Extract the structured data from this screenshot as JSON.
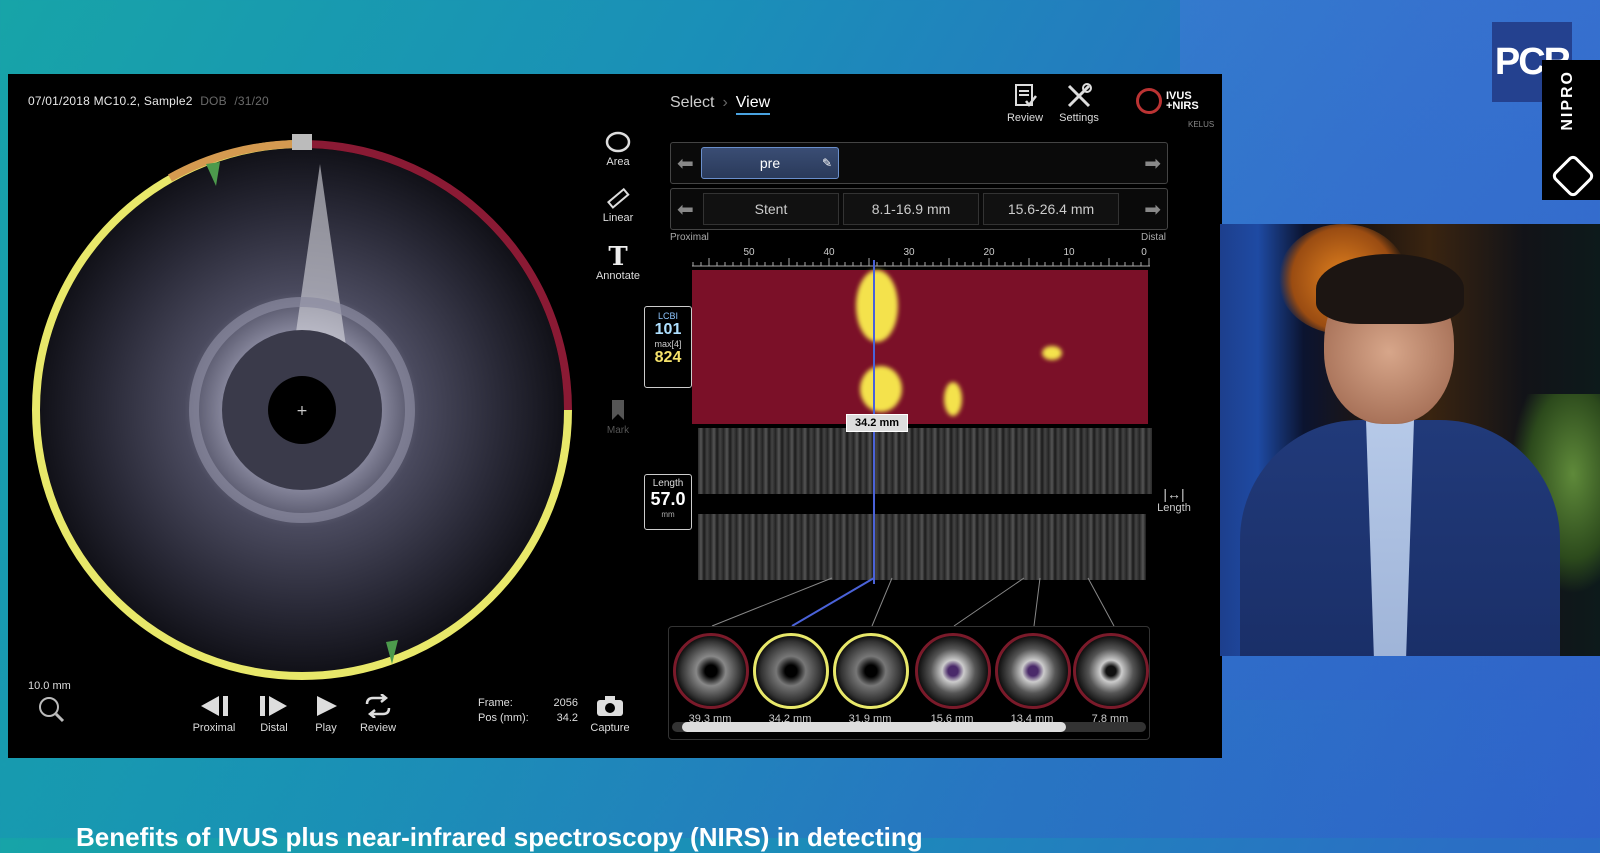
{
  "header": {
    "info": "07/01/2018  MC10.2, Sample2",
    "dob_label": "DOB",
    "dob_value": "/31/20"
  },
  "breadcrumb": {
    "step1": "Select",
    "separator": "›",
    "step2": "View"
  },
  "toolbar": {
    "review_label": "Review",
    "settings_label": "Settings"
  },
  "logo": {
    "text": "IVUS\n+NIRS",
    "sub": "KELUS"
  },
  "tools": {
    "area": "Area",
    "linear": "Linear",
    "annotate": "Annotate",
    "mark": "Mark"
  },
  "tags_row": {
    "selected_tag": "pre"
  },
  "segments_row": {
    "items": [
      "Stent",
      "8.1-16.9 mm",
      "15.6-26.4 mm"
    ]
  },
  "track": {
    "proximal_label": "Proximal",
    "distal_label": "Distal",
    "ticks": [
      "50",
      "40",
      "30",
      "20",
      "10",
      "0"
    ],
    "cursor_label": "34.2 mm"
  },
  "lcbi": {
    "label1": "LCBI",
    "value1": "101",
    "label2": "max[4]",
    "value2": "824"
  },
  "length_box": {
    "label": "Length",
    "value": "57.0",
    "unit": "mm"
  },
  "length_tool": {
    "label": "Length"
  },
  "thumbnails": [
    {
      "label": "39.3 mm",
      "ring": "#7a1a2a"
    },
    {
      "label": "34.2 mm",
      "ring": "#e8e86a"
    },
    {
      "label": "31.9 mm",
      "ring": "#e8e86a"
    },
    {
      "label": "15.6 mm",
      "ring": "#7a1a2a"
    },
    {
      "label": "13.4 mm",
      "ring": "#7a1a2a"
    },
    {
      "label": "7.8 mm",
      "ring": "#7a1a2a"
    }
  ],
  "scale_label": "10.0 mm",
  "controls": {
    "proximal": "Proximal",
    "distal": "Distal",
    "play": "Play",
    "review": "Review",
    "capture": "Capture"
  },
  "frame_info": {
    "frame_label": "Frame:",
    "frame_value": "2056",
    "pos_label": "Pos (mm):",
    "pos_value": "34.2"
  },
  "branding": {
    "pcr": "PCR",
    "nipro": "NIPRO"
  },
  "caption": "Benefits of IVUS plus near-infrared spectroscopy (NIRS) in detecting"
}
